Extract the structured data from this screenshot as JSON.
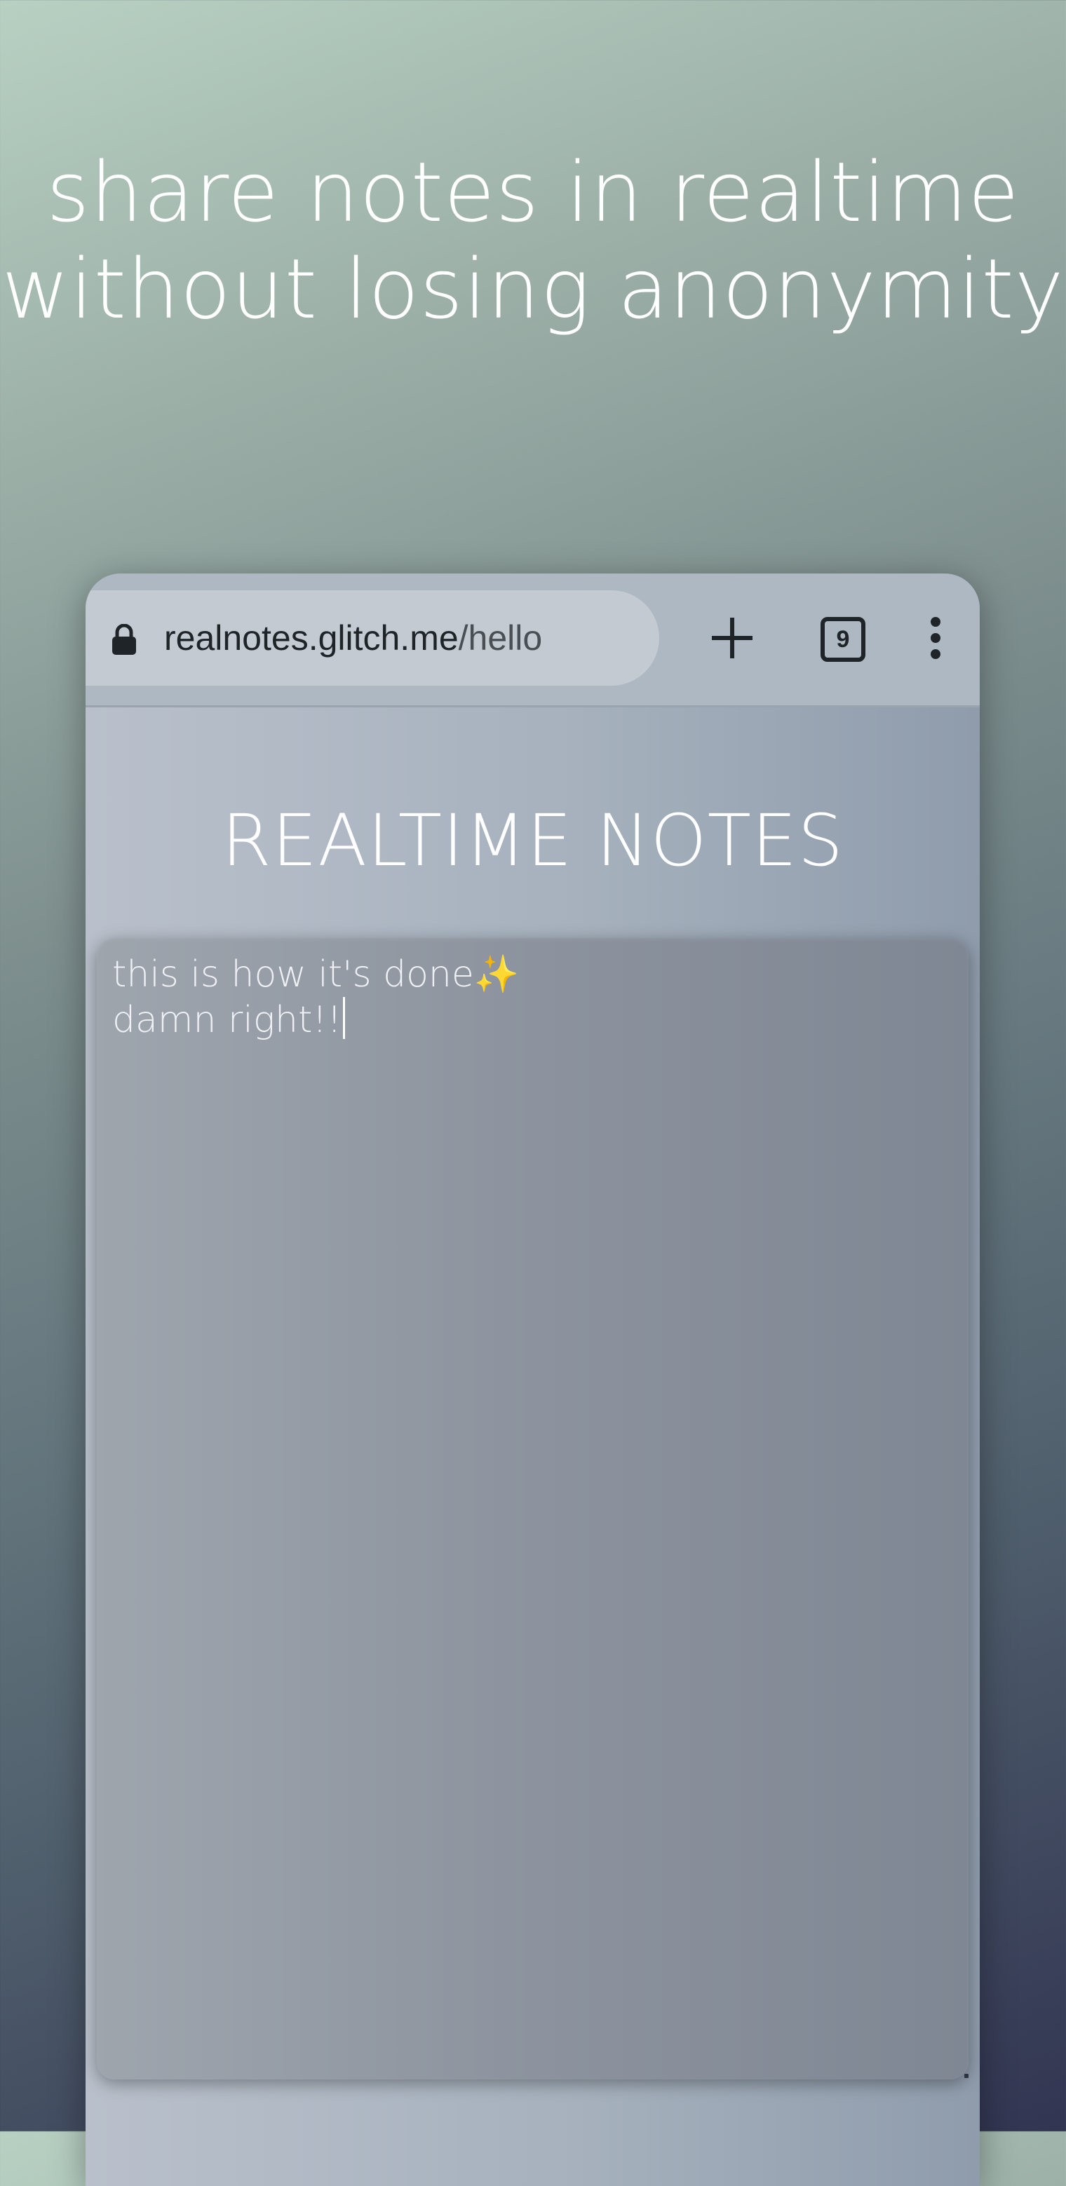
{
  "promo": {
    "line1": "share notes in realtime",
    "line2": "without losing anonymity"
  },
  "browser": {
    "url_host": "realnotes.glitch.me",
    "url_path": "/hello",
    "tab_count": "9",
    "icons": {
      "lock": "lock-icon",
      "new_tab": "plus-icon",
      "menu": "more-vert-icon"
    }
  },
  "app": {
    "title": "REALTIME NOTES",
    "note_lines": [
      "this is how it's done✨",
      "damn right!!"
    ]
  },
  "colors": {
    "headline_text": "#ffffff",
    "toolbar_bg": "#aeb8c2",
    "urlbar_bg": "#c3cad1",
    "note_bg": "#8c939e"
  }
}
